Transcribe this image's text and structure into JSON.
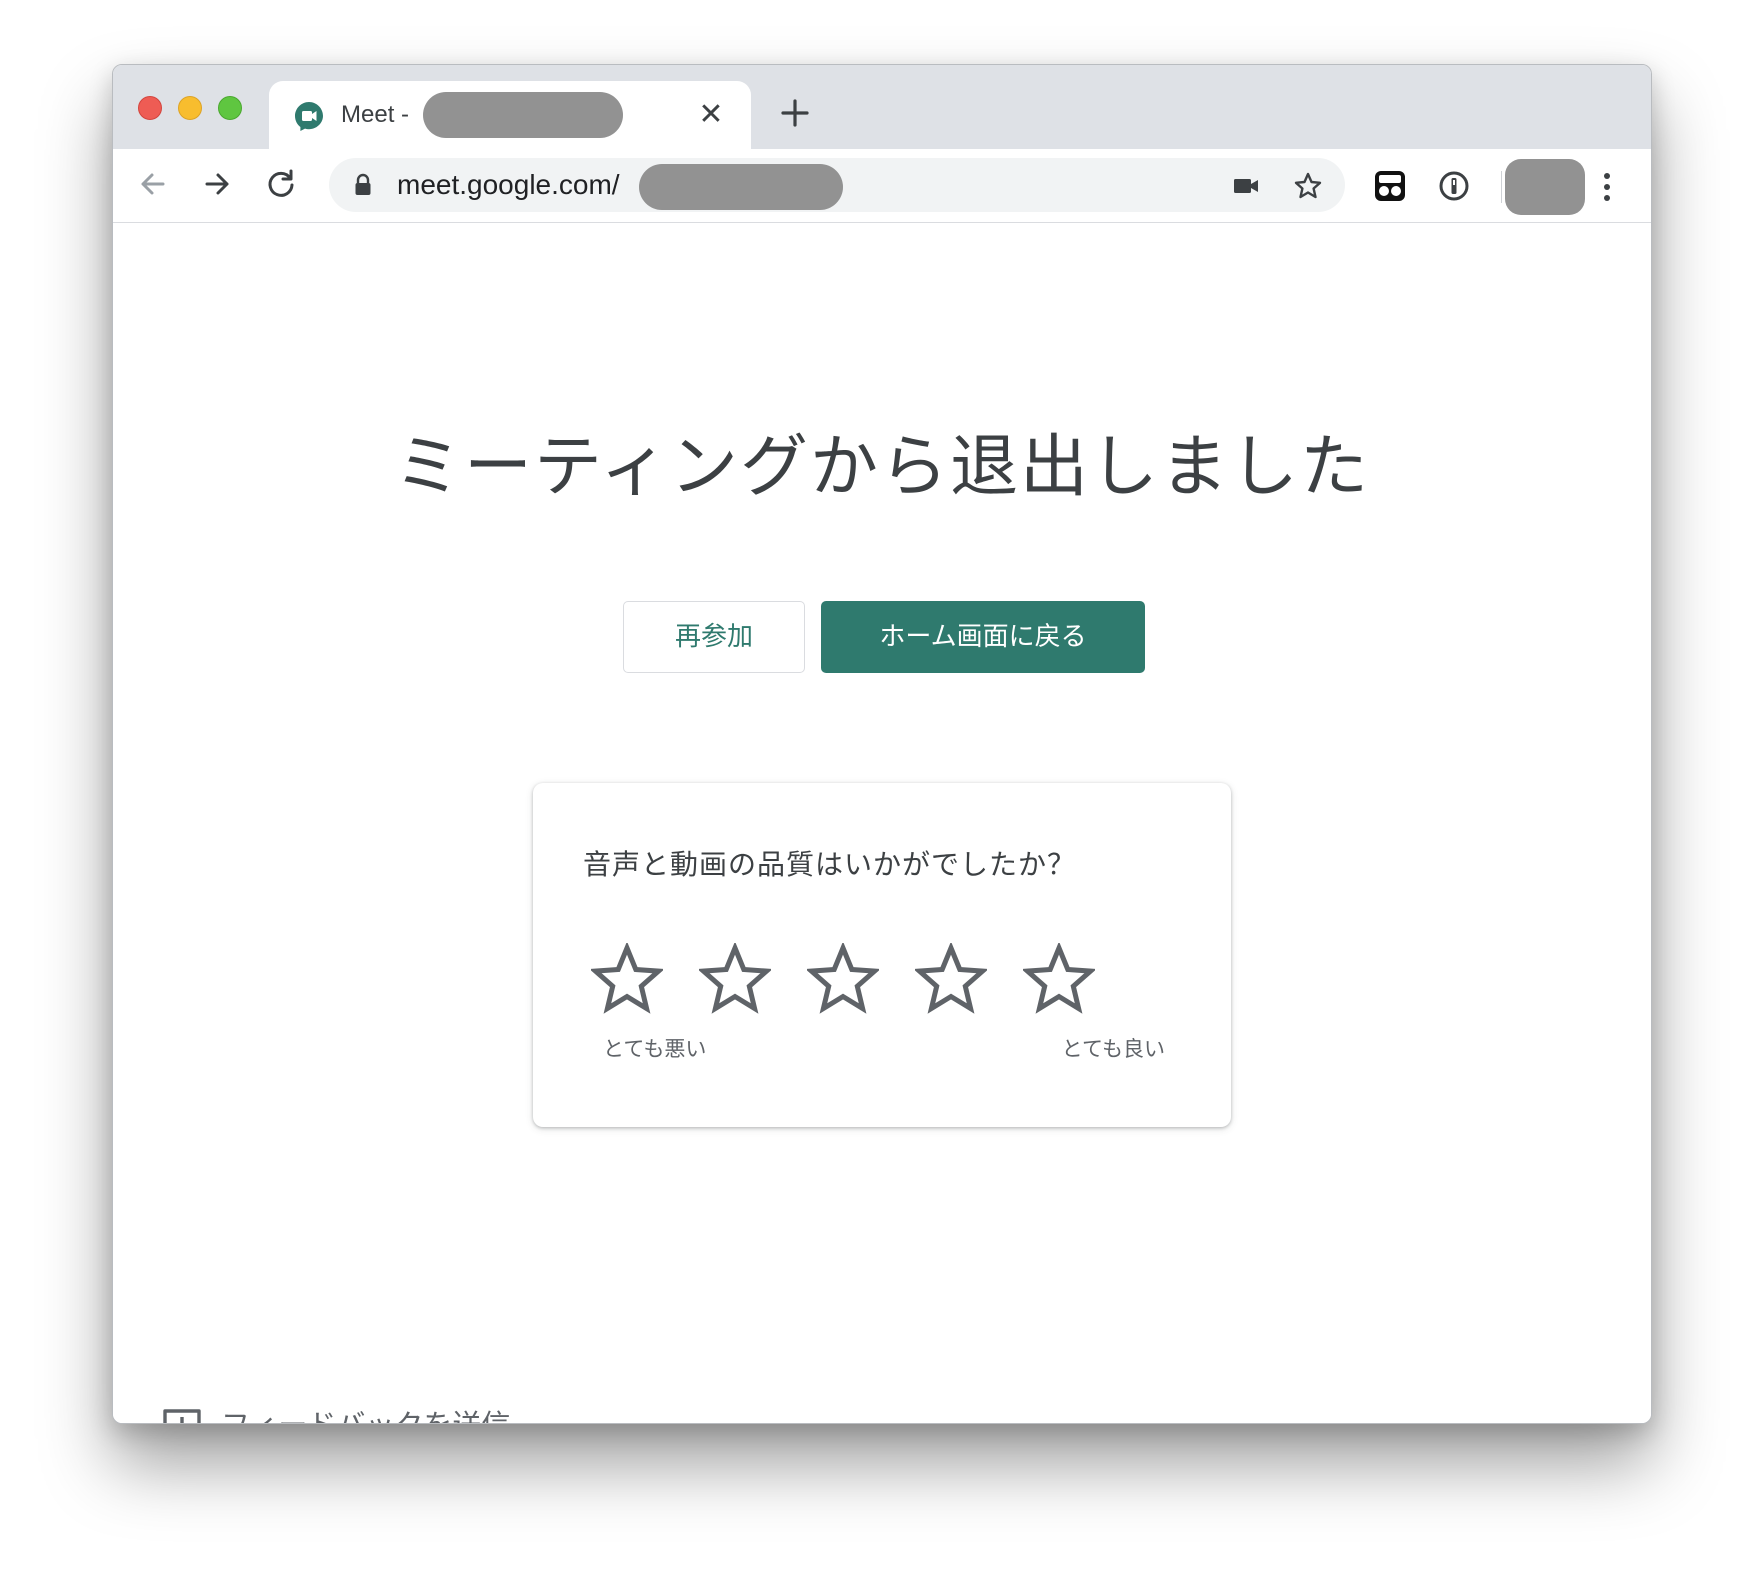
{
  "browser": {
    "tab": {
      "title": "Meet -",
      "close_glyph": "✕",
      "favicon": "google-meet-icon"
    },
    "new_tab_icon": "plus-icon",
    "nav": {
      "back_icon": "arrow-left-icon",
      "forward_icon": "arrow-right-icon",
      "reload_icon": "reload-icon"
    },
    "address": {
      "url": "meet.google.com/",
      "lock_icon": "lock-icon",
      "camera_icon": "video-camera-icon",
      "bookmark_icon": "star-outline-icon"
    },
    "extensions": [
      "incognito-glasses-icon",
      "password-manager-icon"
    ],
    "menu_icon": "vertical-dots-icon"
  },
  "page": {
    "heading": "ミーティングから退出しました",
    "rejoin_label": "再参加",
    "home_label": "ホーム画面に戻る",
    "rating_card": {
      "question": "音声と動画の品質はいかがでしたか？",
      "star_count": 5,
      "selected_stars": 0,
      "low_label": "とても悪い",
      "high_label": "とても良い"
    },
    "feedback_label": "フィードバックを送信",
    "feedback_icon": "feedback-icon"
  },
  "colors": {
    "accent": "#2f7a6e",
    "tabbar_bg": "#dee1e6",
    "omnibox_bg": "#f1f3f4",
    "text_primary": "#3c4043",
    "text_secondary": "#5f6368",
    "redaction": "#929292"
  }
}
